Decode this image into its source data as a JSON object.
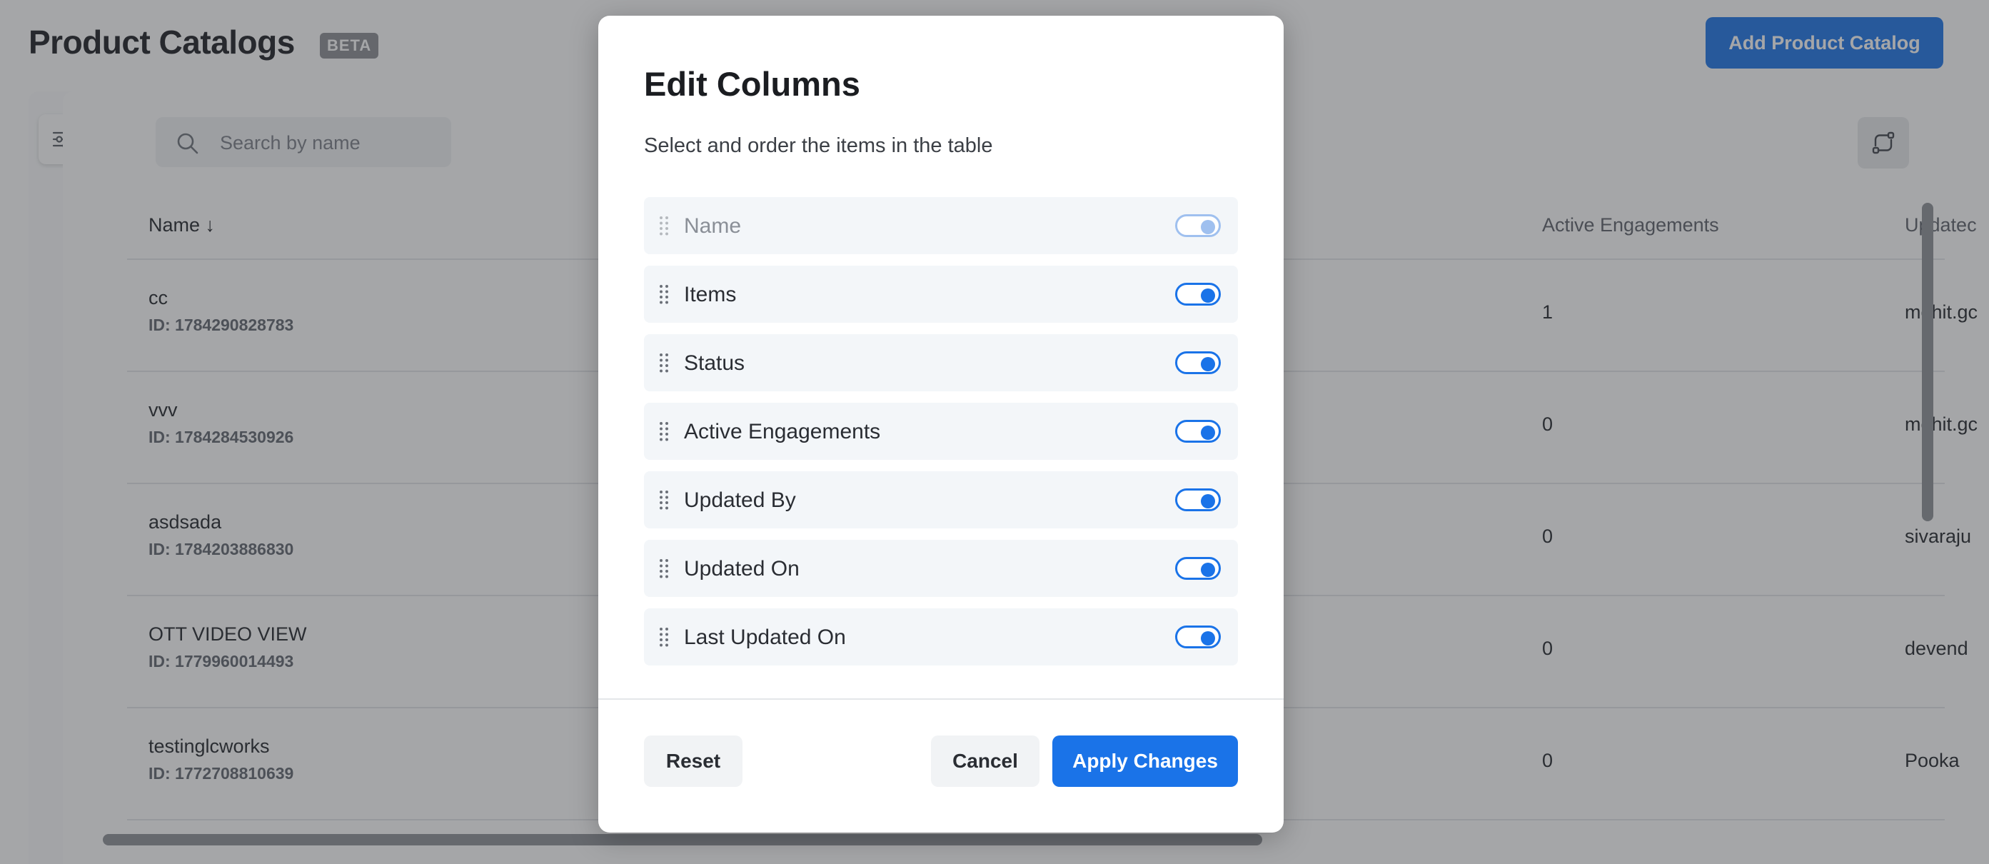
{
  "header": {
    "title": "Product Catalogs",
    "badge": "BETA",
    "add_button": "Add Product Catalog"
  },
  "search": {
    "placeholder": "Search by name"
  },
  "table": {
    "columns": {
      "name": "Name ↓",
      "active_engagements": "Active Engagements",
      "updated_by": "Updatec"
    },
    "rows": [
      {
        "name": "cc",
        "id": "ID: 1784290828783",
        "active_engagements": "1",
        "updated_by": "mohit.gc"
      },
      {
        "name": "vvv",
        "id": "ID: 1784284530926",
        "active_engagements": "0",
        "updated_by": "mohit.gc"
      },
      {
        "name": "asdsada",
        "id": "ID: 1784203886830",
        "active_engagements": "0",
        "updated_by": "sivaraju"
      },
      {
        "name": "OTT VIDEO VIEW",
        "id": "ID: 1779960014493",
        "active_engagements": "0",
        "updated_by": "devend"
      },
      {
        "name": "testinglcworks",
        "id": "ID: 1772708810639",
        "active_engagements": "0",
        "updated_by": "Pooka"
      }
    ]
  },
  "modal": {
    "title": "Edit Columns",
    "subtitle": "Select and order the items in the table",
    "items": [
      {
        "label": "Name",
        "enabled": true,
        "locked": true
      },
      {
        "label": "Items",
        "enabled": true,
        "locked": false
      },
      {
        "label": "Status",
        "enabled": true,
        "locked": false
      },
      {
        "label": "Active Engagements",
        "enabled": true,
        "locked": false
      },
      {
        "label": "Updated By",
        "enabled": true,
        "locked": false
      },
      {
        "label": "Updated On",
        "enabled": true,
        "locked": false
      },
      {
        "label": "Last Updated On",
        "enabled": true,
        "locked": false
      }
    ],
    "reset_label": "Reset",
    "cancel_label": "Cancel",
    "apply_label": "Apply Changes"
  },
  "colors": {
    "accent": "#1a73e8",
    "overlay": "rgba(56,58,62,0.45)"
  },
  "icons": {
    "filter": "sliders-icon",
    "search": "search-icon",
    "columns_switch": "swap-icon",
    "drag": "drag-handle-icon"
  }
}
